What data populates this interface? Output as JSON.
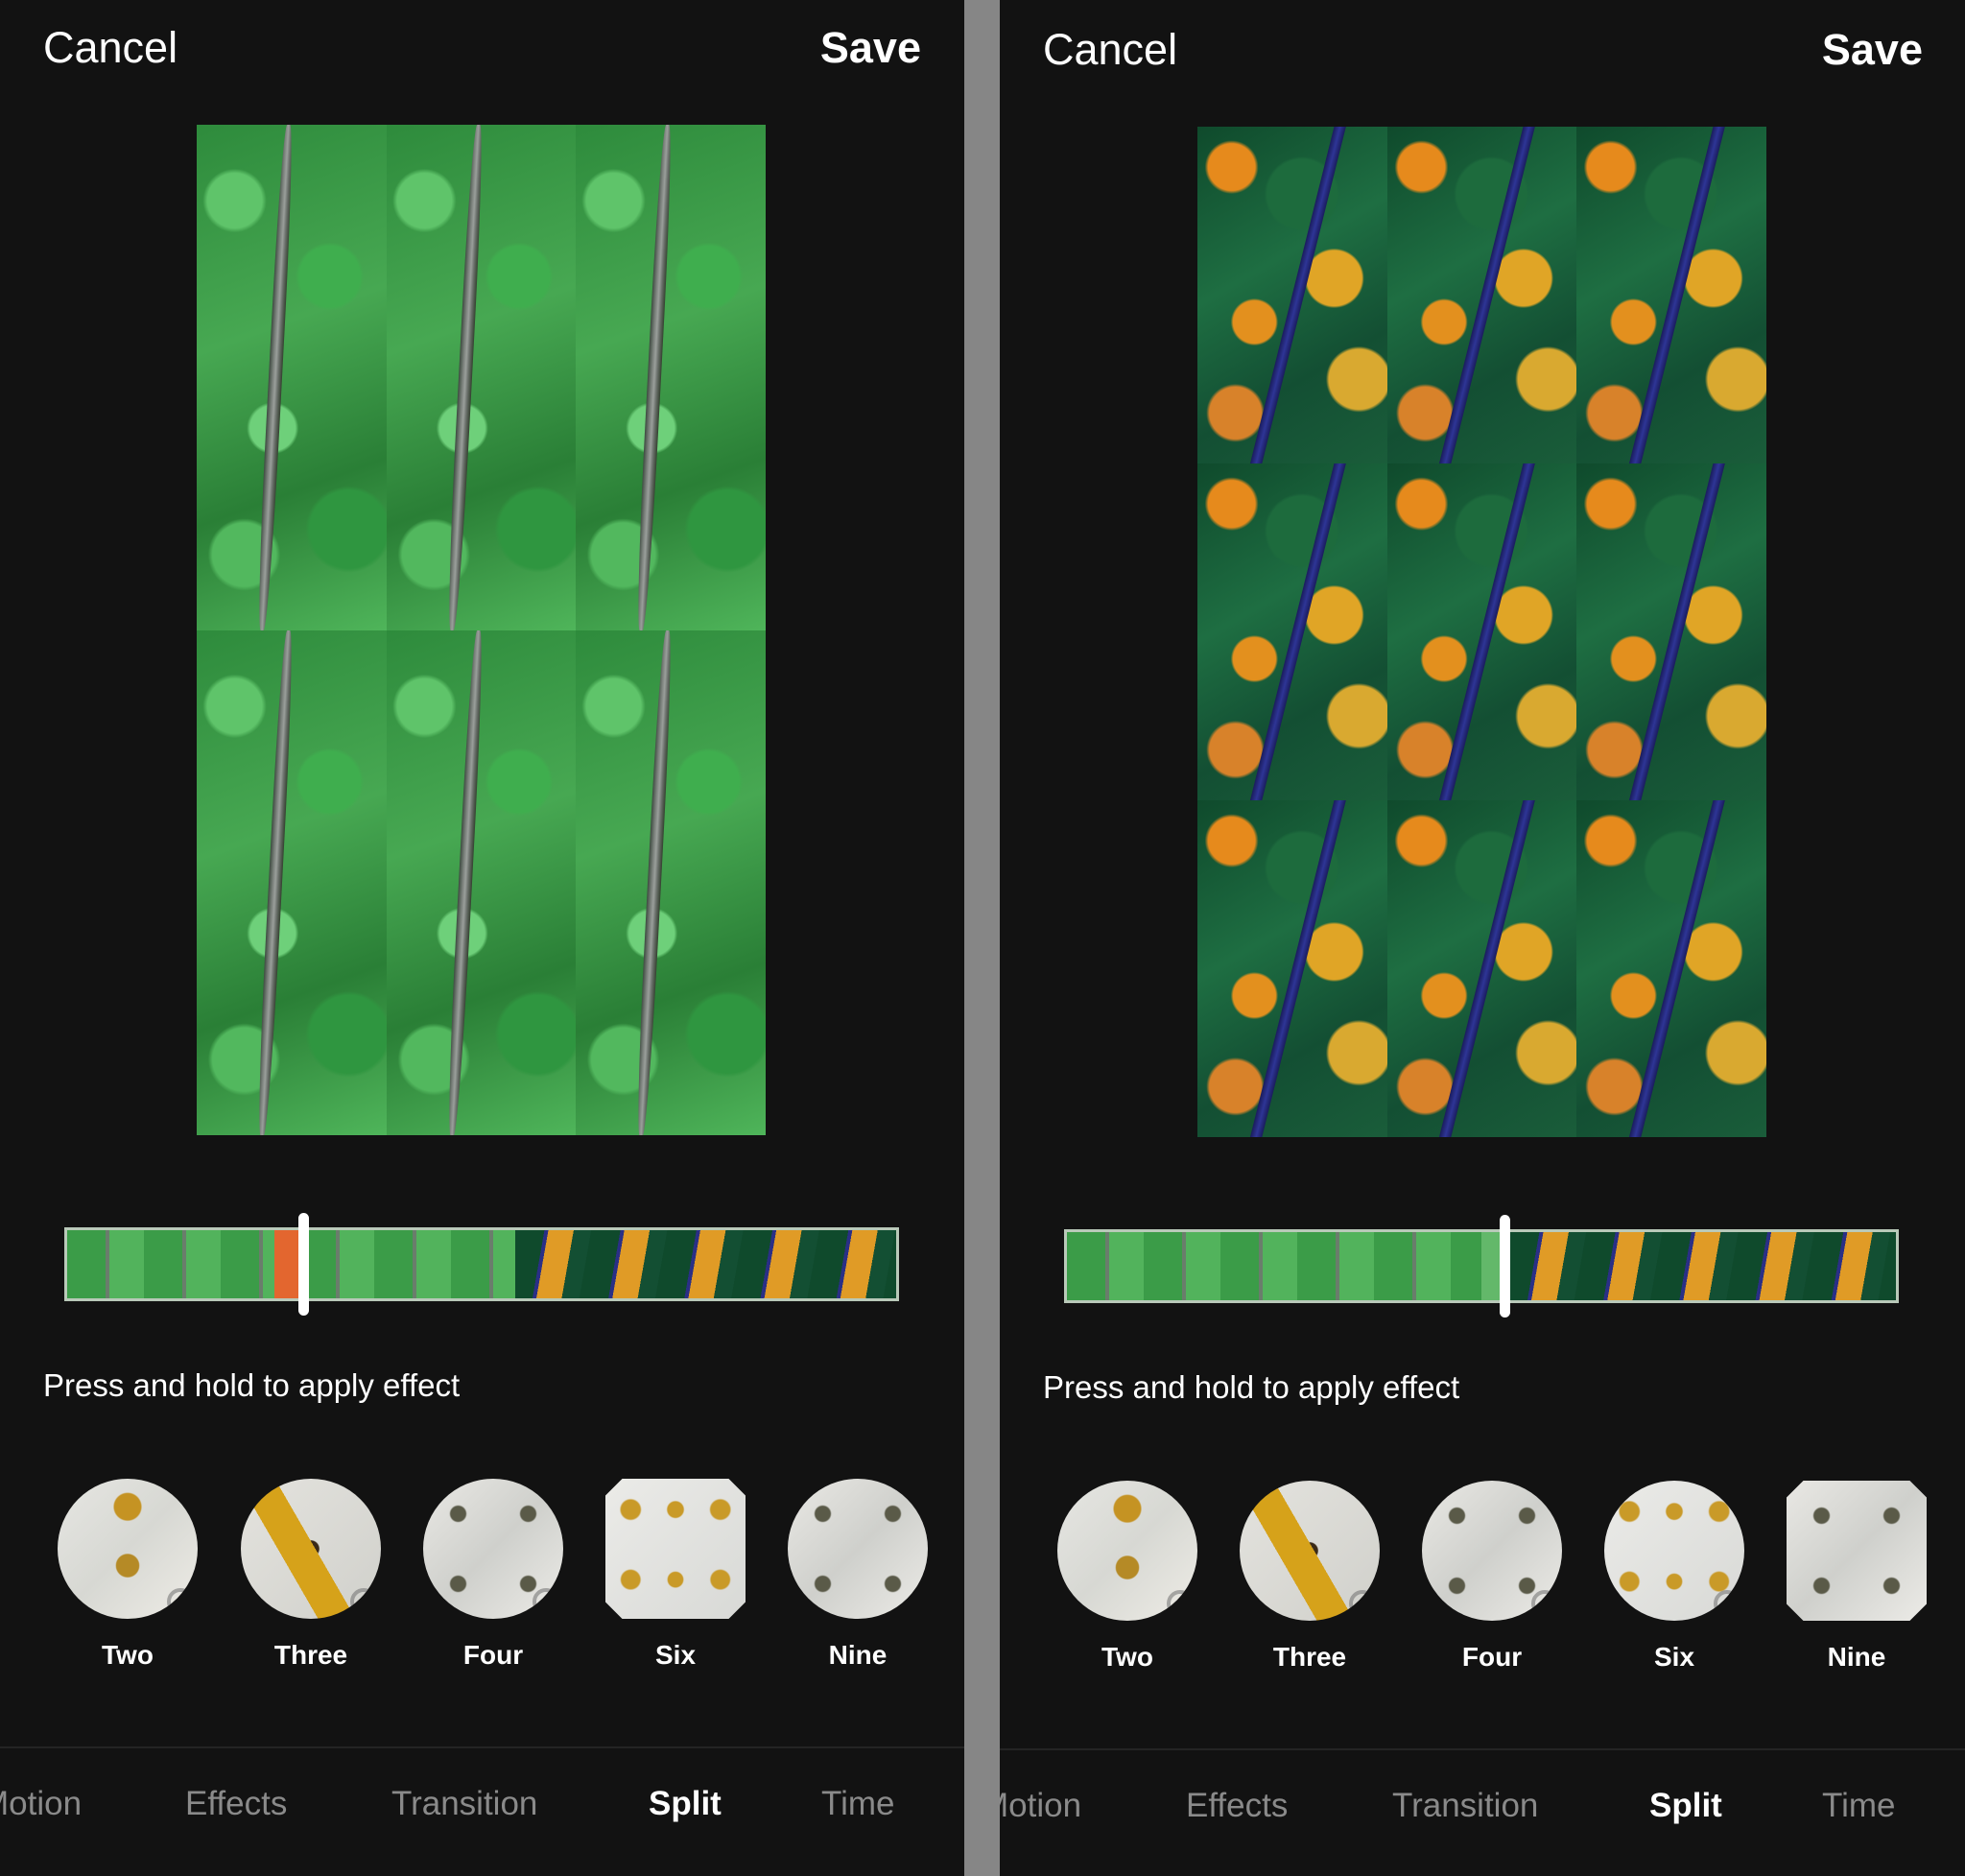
{
  "panels": [
    {
      "id": "left",
      "header": {
        "cancel_label": "Cancel",
        "save_label": "Save"
      },
      "preview": {
        "split": "Six",
        "grid_cols": 3,
        "grid_rows": 2,
        "theme": "green-forest"
      },
      "timeline": {
        "segments": [
          "green-forest",
          "autumn-forest"
        ],
        "green_fraction": 0.54,
        "applied_effect_color": "#E3662F",
        "applied_effect_range": [
          0.25,
          0.29
        ],
        "playhead_position": 0.286
      },
      "hint": "Press and hold to apply effect",
      "effects": [
        {
          "label": "Two",
          "icon": "two-split-thumb"
        },
        {
          "label": "Three",
          "icon": "three-split-thumb"
        },
        {
          "label": "Four",
          "icon": "four-split-thumb"
        },
        {
          "label": "Six",
          "icon": "six-split-thumb"
        },
        {
          "label": "Nine",
          "icon": "nine-split-thumb"
        }
      ],
      "tabs": [
        {
          "label": "Motion",
          "active": false
        },
        {
          "label": "Effects",
          "active": false
        },
        {
          "label": "Transition",
          "active": false
        },
        {
          "label": "Split",
          "active": true
        },
        {
          "label": "Time",
          "active": false
        }
      ]
    },
    {
      "id": "right",
      "header": {
        "cancel_label": "Cancel",
        "save_label": "Save"
      },
      "preview": {
        "split": "Nine",
        "grid_cols": 3,
        "grid_rows": 3,
        "theme": "autumn-forest"
      },
      "timeline": {
        "segments": [
          "green-forest",
          "autumn-forest"
        ],
        "green_fraction": 0.535,
        "applied_effect_color": "#63B86A",
        "applied_effect_range": [
          0.5,
          0.535
        ],
        "playhead_position": 0.528
      },
      "hint": "Press and hold to apply effect",
      "effects": [
        {
          "label": "Two",
          "icon": "two-split-thumb"
        },
        {
          "label": "Three",
          "icon": "three-split-thumb"
        },
        {
          "label": "Four",
          "icon": "four-split-thumb"
        },
        {
          "label": "Six",
          "icon": "six-split-thumb"
        },
        {
          "label": "Nine",
          "icon": "nine-split-thumb"
        }
      ],
      "tabs": [
        {
          "label": "Motion",
          "active": false
        },
        {
          "label": "Effects",
          "active": false
        },
        {
          "label": "Transition",
          "active": false
        },
        {
          "label": "Split",
          "active": true
        },
        {
          "label": "Time",
          "active": false
        }
      ]
    }
  ],
  "colors": {
    "background": "#121212",
    "divider": "#868686",
    "tab_inactive": "#8A8A8A",
    "tab_active": "#FFFFFF"
  }
}
